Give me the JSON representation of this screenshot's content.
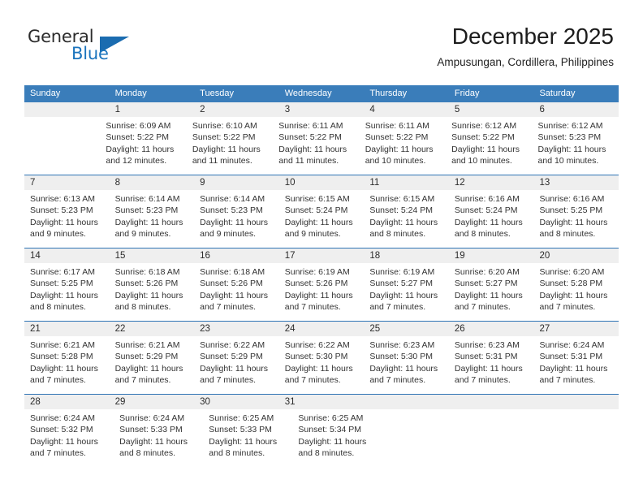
{
  "brand": {
    "name_part1": "General",
    "name_part2": "Blue",
    "flag_icon": "flag-icon",
    "accent_color": "#1b6cb0"
  },
  "header": {
    "title": "December 2025",
    "subtitle": "Ampusungan, Cordillera, Philippines"
  },
  "theme": {
    "header_bar_color": "#3a7dba",
    "daynum_band_color": "#efefef",
    "week_divider_color": "#2f74b5"
  },
  "calendar": {
    "weekday_headers": [
      "Sunday",
      "Monday",
      "Tuesday",
      "Wednesday",
      "Thursday",
      "Friday",
      "Saturday"
    ],
    "weeks": [
      {
        "days": [
          {
            "day": "",
            "lines": []
          },
          {
            "day": "1",
            "lines": [
              "Sunrise: 6:09 AM",
              "Sunset: 5:22 PM",
              "Daylight: 11 hours",
              "and 12 minutes."
            ]
          },
          {
            "day": "2",
            "lines": [
              "Sunrise: 6:10 AM",
              "Sunset: 5:22 PM",
              "Daylight: 11 hours",
              "and 11 minutes."
            ]
          },
          {
            "day": "3",
            "lines": [
              "Sunrise: 6:11 AM",
              "Sunset: 5:22 PM",
              "Daylight: 11 hours",
              "and 11 minutes."
            ]
          },
          {
            "day": "4",
            "lines": [
              "Sunrise: 6:11 AM",
              "Sunset: 5:22 PM",
              "Daylight: 11 hours",
              "and 10 minutes."
            ]
          },
          {
            "day": "5",
            "lines": [
              "Sunrise: 6:12 AM",
              "Sunset: 5:22 PM",
              "Daylight: 11 hours",
              "and 10 minutes."
            ]
          },
          {
            "day": "6",
            "lines": [
              "Sunrise: 6:12 AM",
              "Sunset: 5:23 PM",
              "Daylight: 11 hours",
              "and 10 minutes."
            ]
          }
        ]
      },
      {
        "days": [
          {
            "day": "7",
            "lines": [
              "Sunrise: 6:13 AM",
              "Sunset: 5:23 PM",
              "Daylight: 11 hours",
              "and 9 minutes."
            ]
          },
          {
            "day": "8",
            "lines": [
              "Sunrise: 6:14 AM",
              "Sunset: 5:23 PM",
              "Daylight: 11 hours",
              "and 9 minutes."
            ]
          },
          {
            "day": "9",
            "lines": [
              "Sunrise: 6:14 AM",
              "Sunset: 5:23 PM",
              "Daylight: 11 hours",
              "and 9 minutes."
            ]
          },
          {
            "day": "10",
            "lines": [
              "Sunrise: 6:15 AM",
              "Sunset: 5:24 PM",
              "Daylight: 11 hours",
              "and 9 minutes."
            ]
          },
          {
            "day": "11",
            "lines": [
              "Sunrise: 6:15 AM",
              "Sunset: 5:24 PM",
              "Daylight: 11 hours",
              "and 8 minutes."
            ]
          },
          {
            "day": "12",
            "lines": [
              "Sunrise: 6:16 AM",
              "Sunset: 5:24 PM",
              "Daylight: 11 hours",
              "and 8 minutes."
            ]
          },
          {
            "day": "13",
            "lines": [
              "Sunrise: 6:16 AM",
              "Sunset: 5:25 PM",
              "Daylight: 11 hours",
              "and 8 minutes."
            ]
          }
        ]
      },
      {
        "days": [
          {
            "day": "14",
            "lines": [
              "Sunrise: 6:17 AM",
              "Sunset: 5:25 PM",
              "Daylight: 11 hours",
              "and 8 minutes."
            ]
          },
          {
            "day": "15",
            "lines": [
              "Sunrise: 6:18 AM",
              "Sunset: 5:26 PM",
              "Daylight: 11 hours",
              "and 8 minutes."
            ]
          },
          {
            "day": "16",
            "lines": [
              "Sunrise: 6:18 AM",
              "Sunset: 5:26 PM",
              "Daylight: 11 hours",
              "and 7 minutes."
            ]
          },
          {
            "day": "17",
            "lines": [
              "Sunrise: 6:19 AM",
              "Sunset: 5:26 PM",
              "Daylight: 11 hours",
              "and 7 minutes."
            ]
          },
          {
            "day": "18",
            "lines": [
              "Sunrise: 6:19 AM",
              "Sunset: 5:27 PM",
              "Daylight: 11 hours",
              "and 7 minutes."
            ]
          },
          {
            "day": "19",
            "lines": [
              "Sunrise: 6:20 AM",
              "Sunset: 5:27 PM",
              "Daylight: 11 hours",
              "and 7 minutes."
            ]
          },
          {
            "day": "20",
            "lines": [
              "Sunrise: 6:20 AM",
              "Sunset: 5:28 PM",
              "Daylight: 11 hours",
              "and 7 minutes."
            ]
          }
        ]
      },
      {
        "days": [
          {
            "day": "21",
            "lines": [
              "Sunrise: 6:21 AM",
              "Sunset: 5:28 PM",
              "Daylight: 11 hours",
              "and 7 minutes."
            ]
          },
          {
            "day": "22",
            "lines": [
              "Sunrise: 6:21 AM",
              "Sunset: 5:29 PM",
              "Daylight: 11 hours",
              "and 7 minutes."
            ]
          },
          {
            "day": "23",
            "lines": [
              "Sunrise: 6:22 AM",
              "Sunset: 5:29 PM",
              "Daylight: 11 hours",
              "and 7 minutes."
            ]
          },
          {
            "day": "24",
            "lines": [
              "Sunrise: 6:22 AM",
              "Sunset: 5:30 PM",
              "Daylight: 11 hours",
              "and 7 minutes."
            ]
          },
          {
            "day": "25",
            "lines": [
              "Sunrise: 6:23 AM",
              "Sunset: 5:30 PM",
              "Daylight: 11 hours",
              "and 7 minutes."
            ]
          },
          {
            "day": "26",
            "lines": [
              "Sunrise: 6:23 AM",
              "Sunset: 5:31 PM",
              "Daylight: 11 hours",
              "and 7 minutes."
            ]
          },
          {
            "day": "27",
            "lines": [
              "Sunrise: 6:24 AM",
              "Sunset: 5:31 PM",
              "Daylight: 11 hours",
              "and 7 minutes."
            ]
          }
        ]
      },
      {
        "days": [
          {
            "day": "28",
            "lines": [
              "Sunrise: 6:24 AM",
              "Sunset: 5:32 PM",
              "Daylight: 11 hours",
              "and 7 minutes."
            ]
          },
          {
            "day": "29",
            "lines": [
              "Sunrise: 6:24 AM",
              "Sunset: 5:33 PM",
              "Daylight: 11 hours",
              "and 8 minutes."
            ]
          },
          {
            "day": "30",
            "lines": [
              "Sunrise: 6:25 AM",
              "Sunset: 5:33 PM",
              "Daylight: 11 hours",
              "and 8 minutes."
            ]
          },
          {
            "day": "31",
            "lines": [
              "Sunrise: 6:25 AM",
              "Sunset: 5:34 PM",
              "Daylight: 11 hours",
              "and 8 minutes."
            ]
          },
          {
            "day": "",
            "lines": []
          },
          {
            "day": "",
            "lines": []
          },
          {
            "day": "",
            "lines": []
          }
        ]
      }
    ]
  }
}
